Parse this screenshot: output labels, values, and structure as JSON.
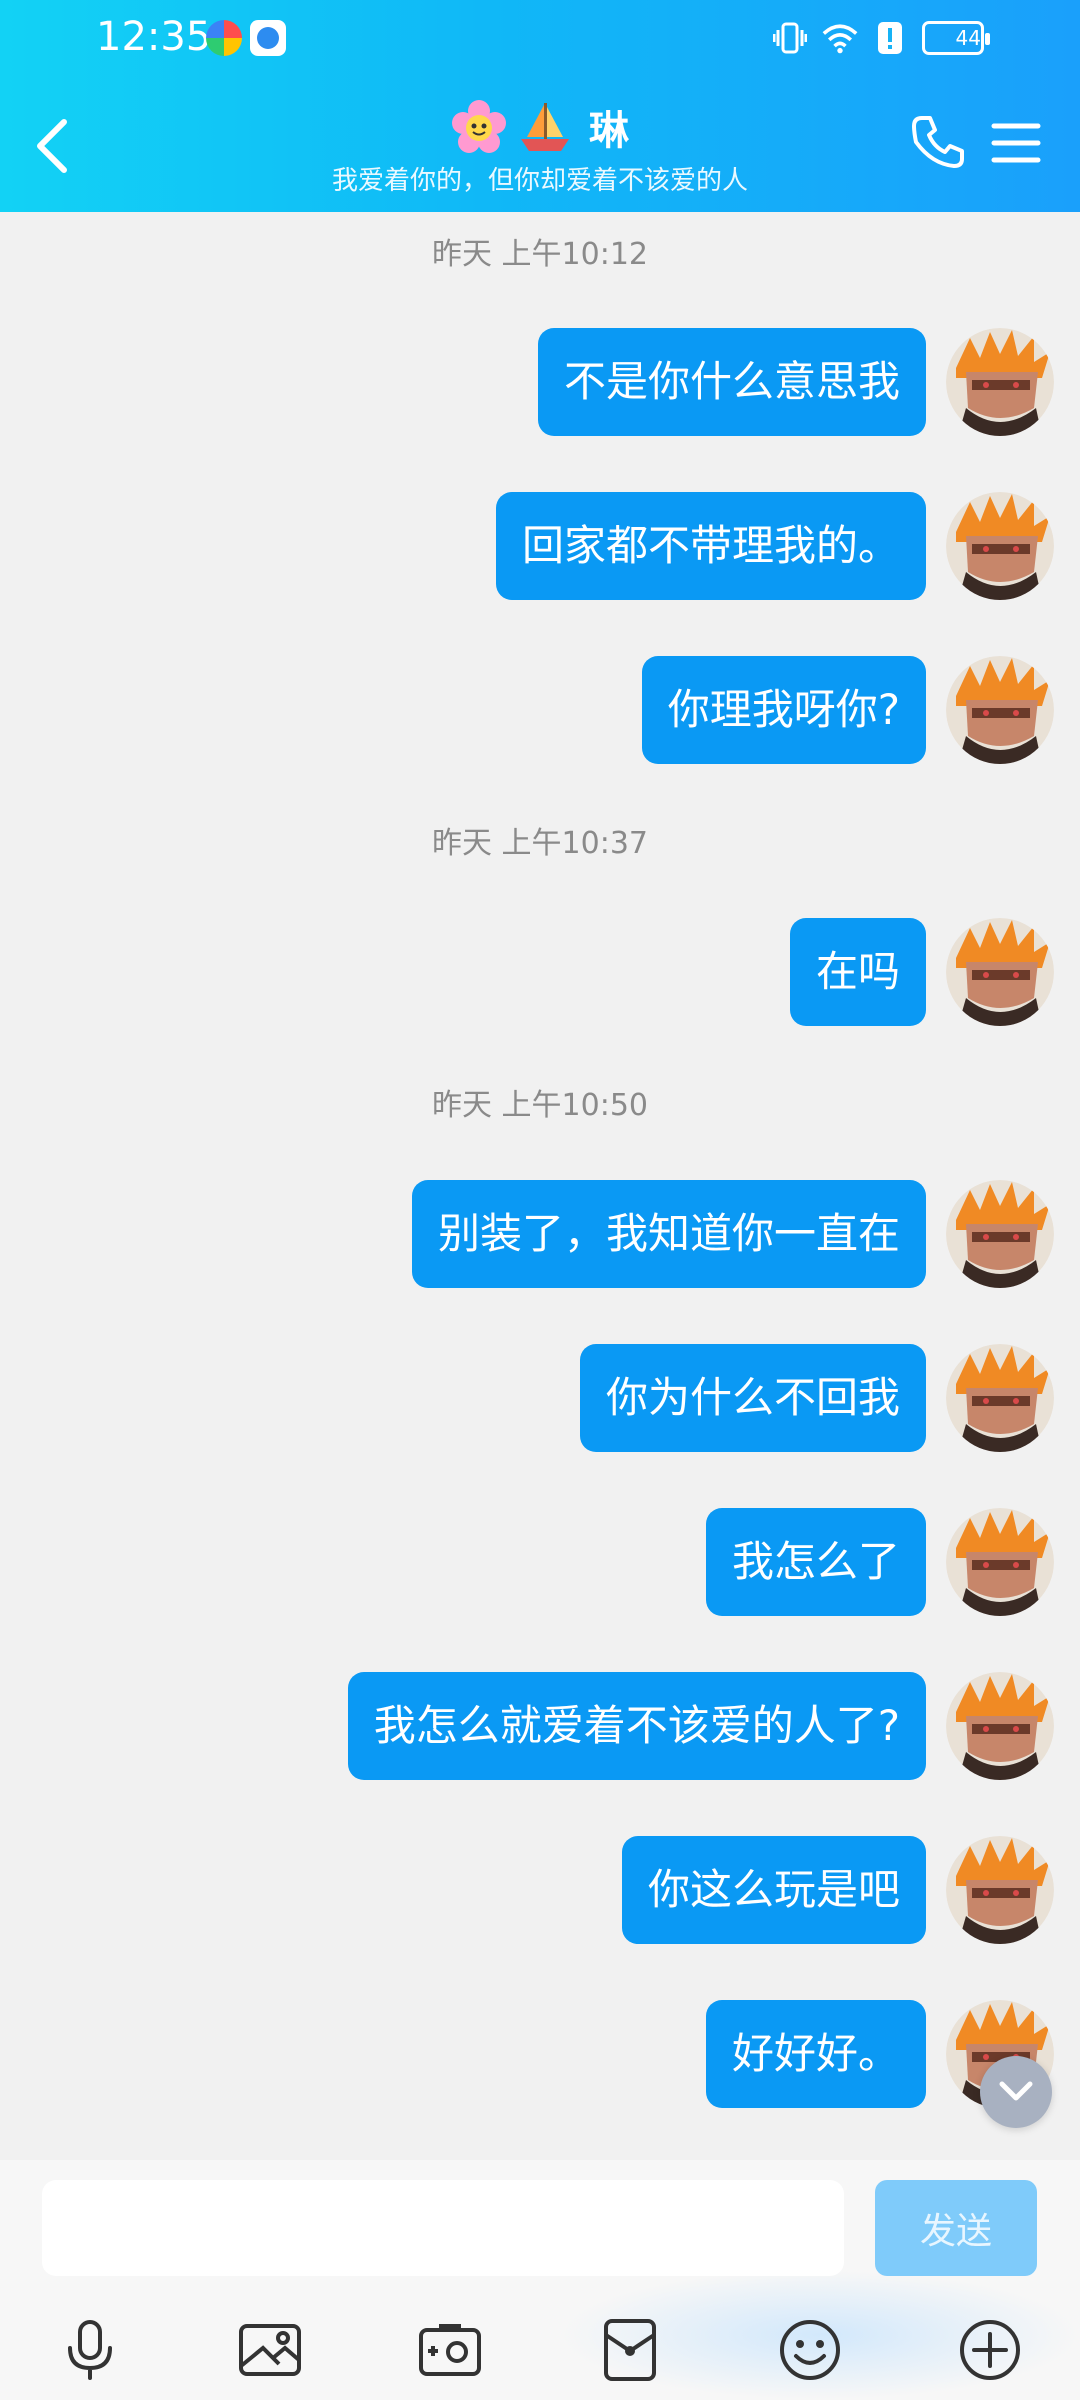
{
  "status_bar": {
    "time": "12:35",
    "battery": "44"
  },
  "header": {
    "title": "琳",
    "subtitle": "我爱着你的，但你却爱着不该爱的人",
    "gradient_start": "#12d2f5",
    "gradient_end": "#1aa0fb"
  },
  "timestamps": [
    "昨天 上午10:12",
    "昨天 上午10:37",
    "昨天 上午10:50"
  ],
  "messages": [
    "不是你什么意思我",
    "回家都不带理我的。",
    "你理我呀你?",
    "在吗",
    "别装了，我知道你一直在",
    "你为什么不回我",
    "我怎么了",
    "我怎么就爱着不该爱的人了?",
    "你这么玩是吧",
    "好好好。"
  ],
  "input": {
    "value": "",
    "placeholder": "",
    "send_label": "发送"
  },
  "colors": {
    "bubble": "#0a99f4",
    "send_disabled": "#7fcbfa",
    "chat_bg": "#f1f1f1"
  },
  "toolbar_icons": [
    "mic-icon",
    "image-icon",
    "camera-icon",
    "red-packet-icon",
    "emoji-icon",
    "plus-icon"
  ]
}
